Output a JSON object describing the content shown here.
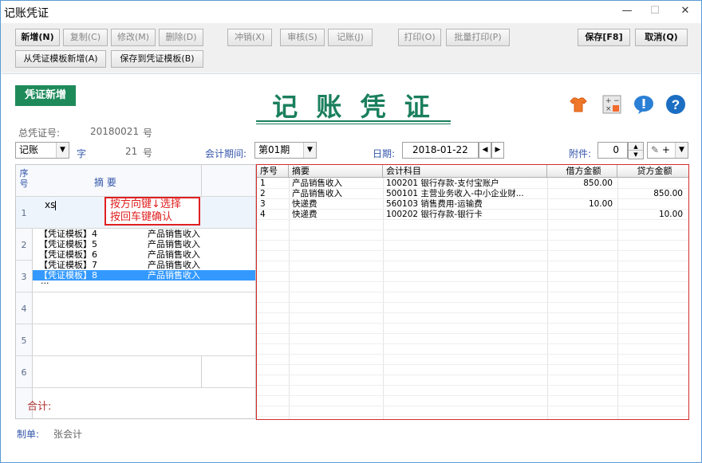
{
  "window": {
    "title": "记账凭证",
    "minimize": "—",
    "maximize": "☐",
    "close": "✕"
  },
  "toolbar": {
    "new": "新增(N)",
    "copy": "复制(C)",
    "edit": "修改(M)",
    "delete": "删除(D)",
    "reverse": "冲销(X)",
    "audit": "审核(S)",
    "post": "记账(J)",
    "print": "打印(O)",
    "batch_print": "批量打印(P)",
    "save": "保存[F8]",
    "cancel": "取消(Q)",
    "new_from_template": "从凭证模板新增(A)",
    "save_to_template": "保存到凭证模板(B)"
  },
  "header": {
    "badge": "凭证新增",
    "title": "记 账 凭 证"
  },
  "voucher": {
    "total_no_label": "总凭证号:",
    "total_no_value": "20180021",
    "total_no_unit": "号",
    "word_value": "记账",
    "word_label": "字",
    "number_value": "21",
    "number_unit": "号",
    "period_label": "会计期间:",
    "period_value": "第01期",
    "date_label": "日期:",
    "date_value": "2018-01-22",
    "attach_label": "附件:",
    "attach_value": "0",
    "attach_icon_label": "+"
  },
  "left_grid": {
    "col_seq": "序号",
    "col_summary": "摘     要",
    "rows": [
      "1",
      "2",
      "3",
      "4",
      "5",
      "6"
    ],
    "input_value": "xs",
    "total_label": "合计:"
  },
  "hint": {
    "line1": "按方向键↓选择",
    "line2": "按回车键确认"
  },
  "template_list": [
    {
      "name": "【凭证模板】4",
      "desc": "产品销售收入"
    },
    {
      "name": "【凭证模板】5",
      "desc": "产品销售收入"
    },
    {
      "name": "【凭证模板】6",
      "desc": "产品销售收入"
    },
    {
      "name": "【凭证模板】7",
      "desc": "产品销售收入"
    },
    {
      "name": "【凭证模板】8",
      "desc": "产品销售收入"
    },
    {
      "name": "...",
      "desc": ""
    }
  ],
  "right_grid": {
    "headers": [
      "序号",
      "摘要",
      "会计科目",
      "借方金额",
      "贷方金额"
    ],
    "rows": [
      {
        "seq": "1",
        "summary": "产品销售收入",
        "account": "100201 银行存款-支付宝账户",
        "debit": "850.00",
        "credit": ""
      },
      {
        "seq": "2",
        "summary": "产品销售收入",
        "account": "500101 主营业务收入-中小企业财...",
        "debit": "",
        "credit": "850.00"
      },
      {
        "seq": "3",
        "summary": "快递费",
        "account": "560103 销售费用-运输费",
        "debit": "10.00",
        "credit": ""
      },
      {
        "seq": "4",
        "summary": "快递费",
        "account": "100202 银行存款-银行卡",
        "debit": "",
        "credit": "10.00"
      }
    ]
  },
  "footer": {
    "maker_label": "制单:",
    "maker_value": "张会计"
  }
}
